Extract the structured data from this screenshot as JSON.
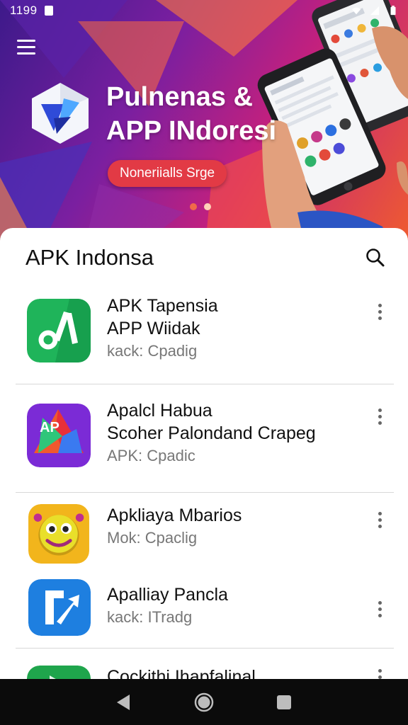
{
  "status_bar": {
    "time": "1199",
    "icons": [
      "notification-icon",
      "wifi-icon",
      "signal-icon",
      "battery-icon"
    ]
  },
  "hero": {
    "menu_icon": "menu-icon",
    "logo_icon": "app-store-logo",
    "title_line1": "Pulnenas &",
    "title_line2": "APP INdoresi",
    "cta_label": "Noneriialls Srge",
    "carousel_pages": 2,
    "carousel_active_index": 1,
    "image": "hands-holding-phones"
  },
  "list": {
    "title": "APK Indonsa",
    "search_icon": "search-icon",
    "items": [
      {
        "lines": [
          "APK Tapensia",
          "APP Wiidak"
        ],
        "meta": "kack: Cpadig",
        "icon": "green-music-icon",
        "more_icon": "more-vertical-icon"
      },
      {
        "lines": [
          "Apalcl Habua",
          "Scoher Palondand Crapeg"
        ],
        "meta": "APK: Cpadic",
        "icon": "purple-ap-icon",
        "more_icon": "more-vertical-icon"
      },
      {
        "lines": [
          "Apkliaya Mbarios"
        ],
        "meta": "Mok: Cpaclig",
        "icon": "yellow-emoji-icon",
        "more_icon": "more-vertical-icon"
      },
      {
        "lines": [
          "Apalliay Pancla"
        ],
        "meta": "kack: ITradg",
        "icon": "blue-arrow-icon",
        "more_icon": "more-vertical-icon"
      },
      {
        "lines": [
          "Cockithi Ihapfalinal"
        ],
        "meta": "",
        "icon": "green-play-icon",
        "more_icon": "more-vertical-icon"
      }
    ]
  },
  "nav_bar": {
    "buttons": [
      "back-icon",
      "home-icon",
      "recents-icon"
    ]
  },
  "colors": {
    "hero_gradient": [
      "#3d1a8a",
      "#7a1fa0",
      "#c2207e",
      "#ef5b30"
    ],
    "cta": "#e23a45",
    "card": "#ffffff",
    "navbar": "#0b0b0b"
  }
}
